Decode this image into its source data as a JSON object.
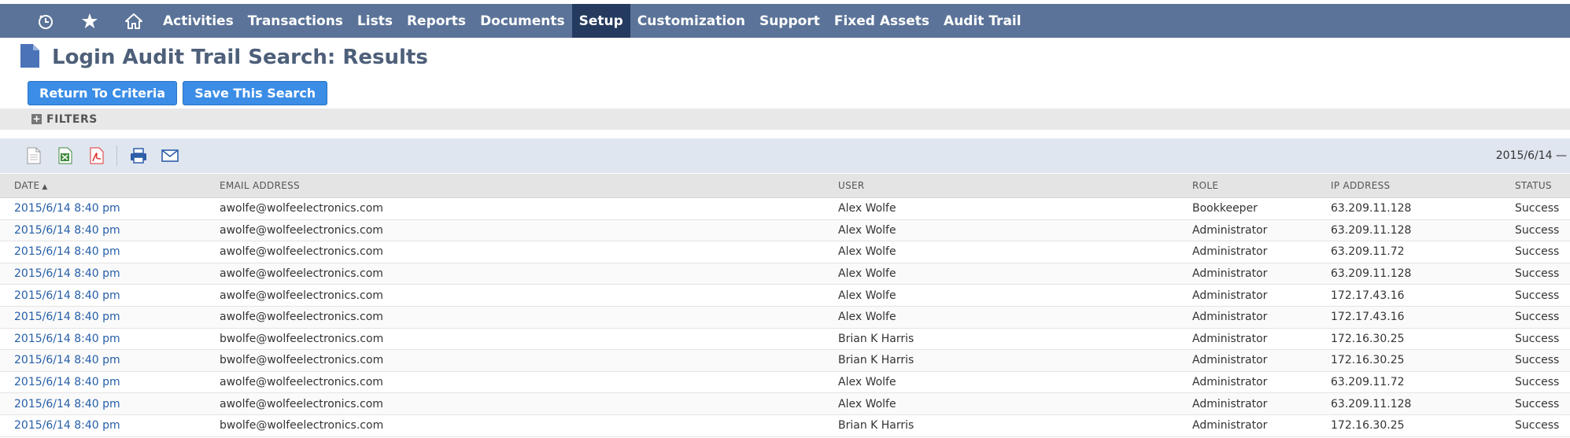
{
  "nav": {
    "icons": [
      "recent-icon",
      "star-icon",
      "home-icon"
    ],
    "items": [
      {
        "label": "Activities",
        "active": false
      },
      {
        "label": "Transactions",
        "active": false
      },
      {
        "label": "Lists",
        "active": false
      },
      {
        "label": "Reports",
        "active": false
      },
      {
        "label": "Documents",
        "active": false
      },
      {
        "label": "Setup",
        "active": true
      },
      {
        "label": "Customization",
        "active": false
      },
      {
        "label": "Support",
        "active": false
      },
      {
        "label": "Fixed Assets",
        "active": false
      },
      {
        "label": "Audit Trail",
        "active": false
      }
    ],
    "colors": {
      "bar": "#5b7398",
      "active": "#243a5e"
    }
  },
  "page": {
    "title": "Login Audit Trail Search: Results",
    "icon": "document-icon"
  },
  "actions": {
    "return_label": "Return To Criteria",
    "save_label": "Save This Search",
    "button_color": "#3b8de6"
  },
  "filters": {
    "toggle": "+",
    "label": "FILTERS"
  },
  "toolbar": {
    "icons": [
      "export-csv-icon",
      "export-excel-icon",
      "export-pdf-icon",
      "print-icon",
      "email-icon"
    ],
    "date_range": "2015/6/14 —"
  },
  "table": {
    "columns": [
      "DATE",
      "EMAIL ADDRESS",
      "USER",
      "ROLE",
      "IP ADDRESS",
      "STATUS"
    ],
    "sort_indicator": "▲",
    "rows": [
      [
        "2015/6/14 8:40 pm",
        "awolfe@wolfeelectronics.com",
        "Alex Wolfe",
        "Bookkeeper",
        "63.209.11.128",
        "Success"
      ],
      [
        "2015/6/14 8:40 pm",
        "awolfe@wolfeelectronics.com",
        "Alex Wolfe",
        "Administrator",
        "63.209.11.128",
        "Success"
      ],
      [
        "2015/6/14 8:40 pm",
        "awolfe@wolfeelectronics.com",
        "Alex Wolfe",
        "Administrator",
        "63.209.11.72",
        "Success"
      ],
      [
        "2015/6/14 8:40 pm",
        "awolfe@wolfeelectronics.com",
        "Alex Wolfe",
        "Administrator",
        "63.209.11.128",
        "Success"
      ],
      [
        "2015/6/14 8:40 pm",
        "awolfe@wolfeelectronics.com",
        "Alex Wolfe",
        "Administrator",
        "172.17.43.16",
        "Success"
      ],
      [
        "2015/6/14 8:40 pm",
        "awolfe@wolfeelectronics.com",
        "Alex Wolfe",
        "Administrator",
        "172.17.43.16",
        "Success"
      ],
      [
        "2015/6/14 8:40 pm",
        "bwolfe@wolfeelectronics.com",
        "Brian K Harris",
        "Administrator",
        "172.16.30.25",
        "Success"
      ],
      [
        "2015/6/14 8:40 pm",
        "bwolfe@wolfeelectronics.com",
        "Brian K Harris",
        "Administrator",
        "172.16.30.25",
        "Success"
      ],
      [
        "2015/6/14 8:40 pm",
        "awolfe@wolfeelectronics.com",
        "Alex Wolfe",
        "Administrator",
        "63.209.11.72",
        "Success"
      ],
      [
        "2015/6/14 8:40 pm",
        "awolfe@wolfeelectronics.com",
        "Alex Wolfe",
        "Administrator",
        "63.209.11.128",
        "Success"
      ],
      [
        "2015/6/14 8:40 pm",
        "bwolfe@wolfeelectronics.com",
        "Brian K Harris",
        "Administrator",
        "172.16.30.25",
        "Success"
      ]
    ]
  }
}
